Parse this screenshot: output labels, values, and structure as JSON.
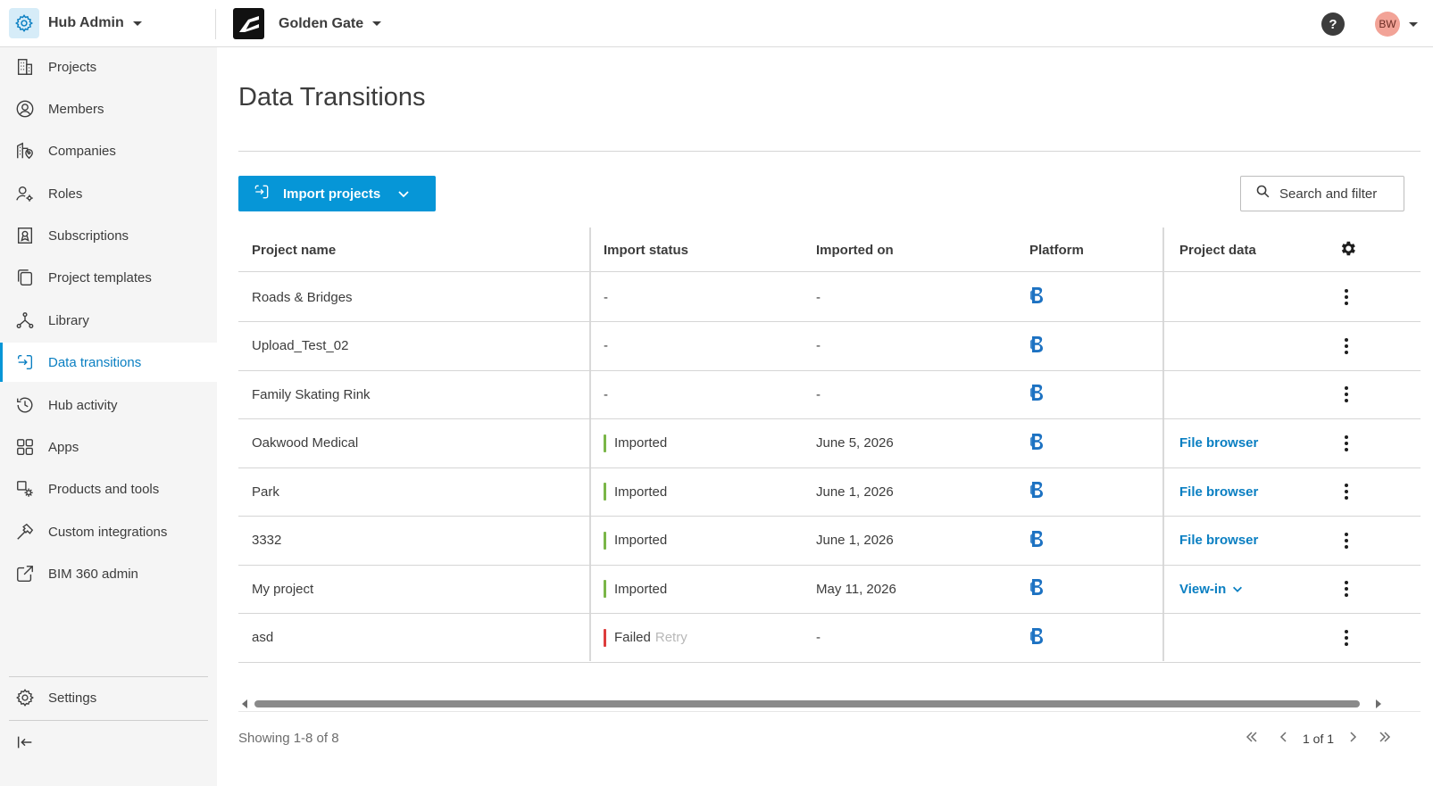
{
  "header": {
    "app_title": "Hub Admin",
    "project_name": "Golden Gate",
    "help_label": "?",
    "user_initials": "BW"
  },
  "sidebar": {
    "items": [
      {
        "label": "Projects",
        "icon": "building-icon"
      },
      {
        "label": "Members",
        "icon": "user-circle-icon"
      },
      {
        "label": "Companies",
        "icon": "company-location-icon"
      },
      {
        "label": "Roles",
        "icon": "user-gear-icon"
      },
      {
        "label": "Subscriptions",
        "icon": "ribbon-badge-icon"
      },
      {
        "label": "Project templates",
        "icon": "template-copy-icon"
      },
      {
        "label": "Library",
        "icon": "library-nodes-icon"
      },
      {
        "label": "Data transitions",
        "icon": "data-transition-icon",
        "active": true
      },
      {
        "label": "Hub activity",
        "icon": "history-icon"
      },
      {
        "label": "Apps",
        "icon": "apps-grid-icon"
      },
      {
        "label": "Products and tools",
        "icon": "products-gear-icon"
      },
      {
        "label": "Custom integrations",
        "icon": "hammer-icon"
      },
      {
        "label": "BIM 360 admin",
        "icon": "external-link-icon"
      }
    ],
    "settings_label": "Settings"
  },
  "page": {
    "title": "Data Transitions",
    "import_button": "Import projects",
    "search_button": "Search and filter"
  },
  "table": {
    "columns": [
      "Project name",
      "Import status",
      "Imported on",
      "Platform",
      "Project data"
    ],
    "rows": [
      {
        "name": "Roads & Bridges",
        "status": "-",
        "status_type": "none",
        "imported_on": "-",
        "project_data": "",
        "project_data_type": "none"
      },
      {
        "name": "Upload_Test_02",
        "status": "-",
        "status_type": "none",
        "imported_on": "-",
        "project_data": "",
        "project_data_type": "none"
      },
      {
        "name": "Family Skating Rink",
        "status": "-",
        "status_type": "none",
        "imported_on": "-",
        "project_data": "",
        "project_data_type": "none"
      },
      {
        "name": "Oakwood Medical",
        "status": "Imported",
        "status_type": "imported",
        "imported_on": "June 5, 2026",
        "project_data": "File browser",
        "project_data_type": "link"
      },
      {
        "name": "Park",
        "status": "Imported",
        "status_type": "imported",
        "imported_on": "June 1, 2026",
        "project_data": "File browser",
        "project_data_type": "link"
      },
      {
        "name": "3332",
        "status": "Imported",
        "status_type": "imported",
        "imported_on": "June 1, 2026",
        "project_data": "File browser",
        "project_data_type": "link"
      },
      {
        "name": "My project",
        "status": "Imported",
        "status_type": "imported",
        "imported_on": "May 11, 2026",
        "project_data": "View-in",
        "project_data_type": "dropdown"
      },
      {
        "name": "asd",
        "status": "Failed",
        "status_type": "failed",
        "retry_label": "Retry",
        "imported_on": "-",
        "project_data": "",
        "project_data_type": "none"
      }
    ]
  },
  "footer": {
    "showing": "Showing 1-8 of 8",
    "page_indicator": "1 of 1"
  },
  "colors": {
    "accent": "#0696d7",
    "link": "#0a7fc2",
    "imported": "#7ab648",
    "failed": "#dd3d3d",
    "platform": "#1d72c2"
  }
}
